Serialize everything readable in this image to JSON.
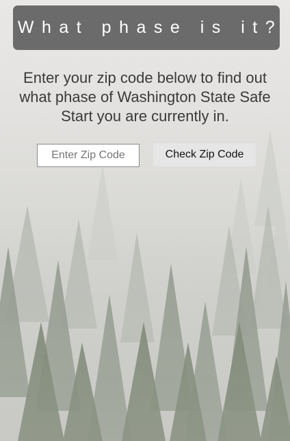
{
  "header": {
    "title": "What phase is it?",
    "bar_color": "#6b6b6b"
  },
  "intro": {
    "text": "Enter your zip code below to find out what phase of Washington State Safe Start you are currently in."
  },
  "zip_form": {
    "input_value": "",
    "input_placeholder": "Enter Zip Code",
    "button_label": "Check Zip Code"
  },
  "background": {
    "image": "foggy-pine-forest",
    "sky_color": "#e6e5e3",
    "tree_color": "#5f6b55"
  }
}
